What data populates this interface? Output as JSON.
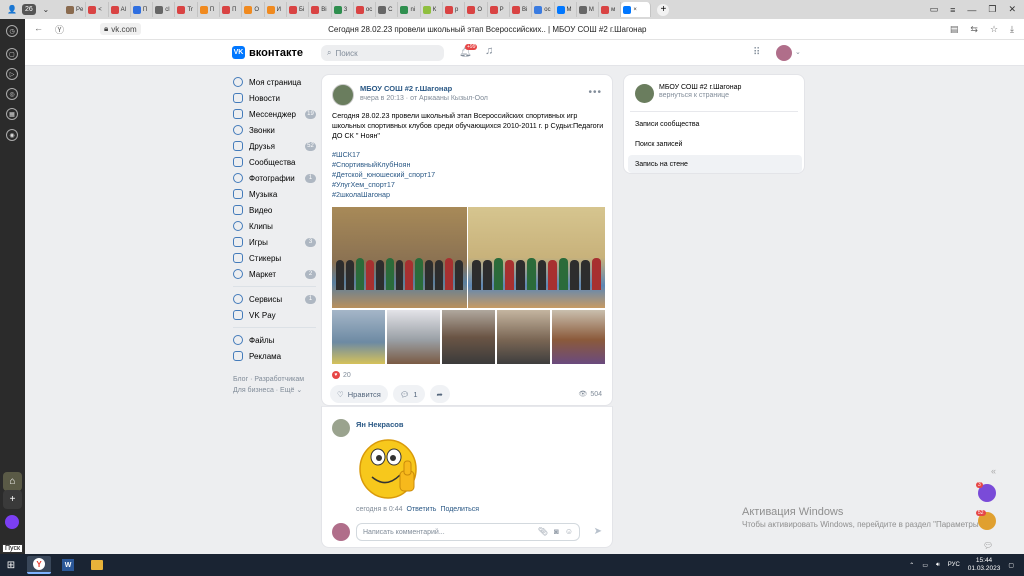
{
  "browser": {
    "tab_count": "26",
    "tabs": [
      {
        "label": "Pe",
        "color": "#8a6b4f"
      },
      {
        "label": "<",
        "color": "#d94343"
      },
      {
        "label": "Al",
        "color": "#d94343"
      },
      {
        "label": "П",
        "color": "#2f6fe0"
      },
      {
        "label": "cl",
        "color": "#666666"
      },
      {
        "label": "Tr",
        "color": "#d94343"
      },
      {
        "label": "П",
        "color": "#f08a1f"
      },
      {
        "label": "П",
        "color": "#d94343"
      },
      {
        "label": "О",
        "color": "#f08a1f"
      },
      {
        "label": "И",
        "color": "#f08a1f"
      },
      {
        "label": "Бi",
        "color": "#d94343"
      },
      {
        "label": "Вi",
        "color": "#d94343"
      },
      {
        "label": "З",
        "color": "#2f8f4f"
      },
      {
        "label": "ос",
        "color": "#d94343"
      },
      {
        "label": "С",
        "color": "#666666"
      },
      {
        "label": "ni",
        "color": "#2f8f4f"
      },
      {
        "label": "К",
        "color": "#8fbf3f"
      },
      {
        "label": "р",
        "color": "#d94343"
      },
      {
        "label": "О",
        "color": "#d94343"
      },
      {
        "label": "Р",
        "color": "#d94343"
      },
      {
        "label": "Вi",
        "color": "#d94343"
      },
      {
        "label": "ос",
        "color": "#3a7be0"
      },
      {
        "label": "М",
        "color": "#0077ff"
      },
      {
        "label": "М",
        "color": "#666666"
      },
      {
        "label": "м",
        "color": "#d94343"
      }
    ],
    "active_tab_label": "×",
    "url": "vk.com",
    "page_title": "Сегодня 28.02.23 провели школьный этап Всероссийских.. | МБОУ СОШ #2 г.Шагонар"
  },
  "vk": {
    "logo_text": "вконтакте",
    "search_placeholder": "Поиск",
    "notifications_badge": "+99"
  },
  "nav": {
    "items": [
      {
        "label": "Моя страница",
        "badge": ""
      },
      {
        "label": "Новости",
        "badge": ""
      },
      {
        "label": "Мессенджер",
        "badge": "19"
      },
      {
        "label": "Звонки",
        "badge": ""
      },
      {
        "label": "Друзья",
        "badge": "52"
      },
      {
        "label": "Сообщества",
        "badge": ""
      },
      {
        "label": "Фотографии",
        "badge": "1"
      },
      {
        "label": "Музыка",
        "badge": ""
      },
      {
        "label": "Видео",
        "badge": ""
      },
      {
        "label": "Клипы",
        "badge": ""
      },
      {
        "label": "Игры",
        "badge": "3"
      },
      {
        "label": "Стикеры",
        "badge": ""
      },
      {
        "label": "Маркет",
        "badge": "2"
      }
    ],
    "items2": [
      {
        "label": "Сервисы",
        "badge": "1"
      },
      {
        "label": "VK Pay",
        "badge": ""
      }
    ],
    "items3": [
      {
        "label": "Файлы",
        "badge": ""
      },
      {
        "label": "Реклама",
        "badge": ""
      }
    ],
    "footer_line1": "Блог · Разработчикам",
    "footer_line2": "Для бизнеса · Ещё ⌄"
  },
  "post": {
    "author": "МБОУ СОШ #2 г.Шагонар",
    "time": "вчера в 20:13",
    "from": "от Аржааны Кызыл-Оол",
    "text": "Сегодня 28.02.23 провели школьный этап Всероссийских спортивных игр школьных спортивных клубов среди обучающихся 2010-2011 г. р Судьи:Педагоги ДО СК \" Ноян\"",
    "hashtags": [
      "#ШСК17",
      "#СпортивныйКлубНоян",
      "#Детской_юношеский_спорт17",
      "#УлугХем_спорт17",
      "#2школаШагонар"
    ],
    "likes_count": "20",
    "like_label": "Нравится",
    "comments_count": "1",
    "views": "504"
  },
  "comment": {
    "author": "Ян Некрасов",
    "time": "сегодня в 0:44",
    "reply": "Ответить",
    "share": "Поделиться",
    "input_placeholder": "Написать комментарий..."
  },
  "side": {
    "group_name": "МБОУ СОШ #2 г.Шагонар",
    "back_link": "вернуться к странице",
    "items": [
      "Записи сообщества",
      "Поиск записей",
      "Запись на стене"
    ]
  },
  "windows": {
    "activation_title": "Активация Windows",
    "activation_text": "Чтобы активировать Windows, перейдите в раздел \"Параметры\".",
    "pusk": "Пуск",
    "lang": "РУС",
    "time": "15:44",
    "date": "01.03.2023",
    "float_badge1": "3",
    "float_badge2": "52"
  }
}
